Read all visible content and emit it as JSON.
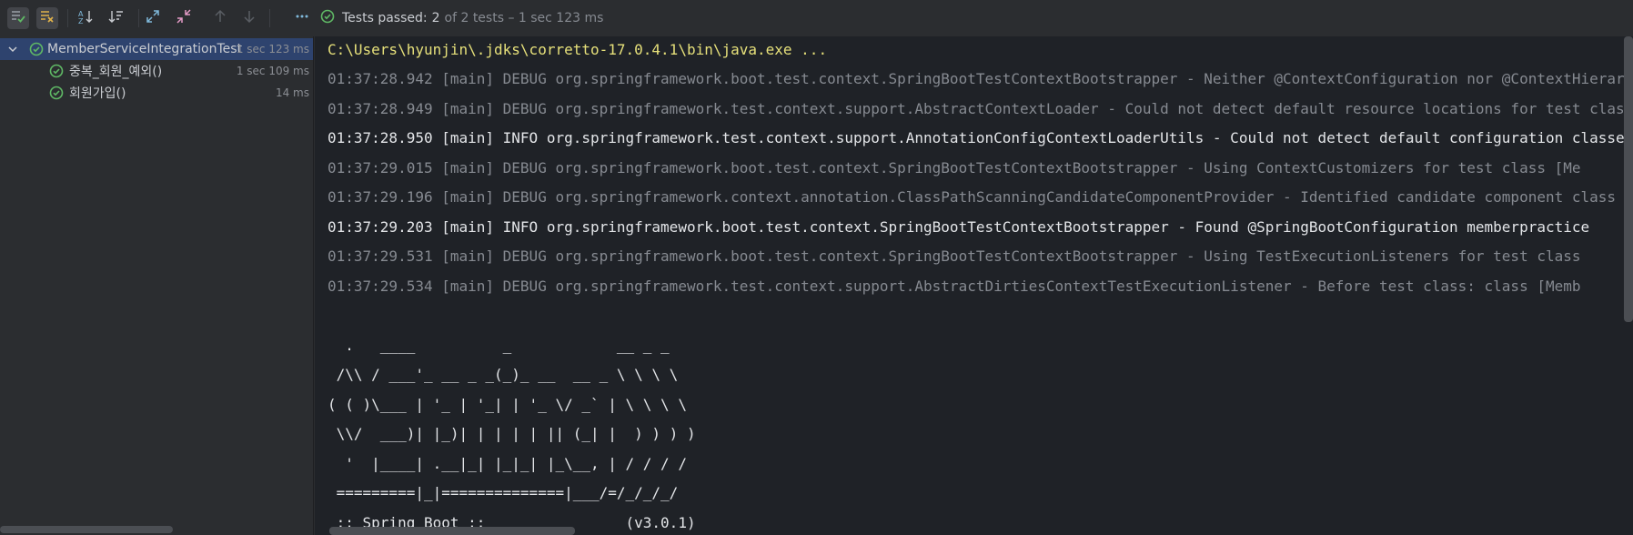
{
  "colors": {
    "accent_green": "#5fb865",
    "toolbar_active_bg": "#43454a",
    "selection_bg": "#2e436e",
    "console_bg": "#1f2227",
    "command_text": "#e6e07a"
  },
  "toolbar": {
    "buttons": [
      {
        "name": "show-passed-icon"
      },
      {
        "name": "show-ignored-icon"
      },
      {
        "name": "sort-alphabetically-icon"
      },
      {
        "name": "sort-by-duration-icon"
      },
      {
        "name": "expand-all-icon"
      },
      {
        "name": "collapse-all-icon"
      },
      {
        "name": "previous-failed-icon"
      },
      {
        "name": "next-failed-icon"
      },
      {
        "name": "more-options-icon"
      }
    ],
    "status_label": "Tests passed:",
    "status_count": "2",
    "status_rest": "of 2 tests – 1 sec 123 ms"
  },
  "tree": {
    "root": {
      "name": "MemberServiceIntegrationTest",
      "time": "1 sec 123 ms"
    },
    "children": [
      {
        "name": "중복_회원_예외()",
        "time": "1 sec 109 ms"
      },
      {
        "name": "회원가입()",
        "time": "14 ms"
      }
    ]
  },
  "console": {
    "command": "C:\\Users\\hyunjin\\.jdks\\corretto-17.0.4.1\\bin\\java.exe ...",
    "logs": [
      {
        "level": "debug",
        "text": "01:37:28.942 [main] DEBUG org.springframework.boot.test.context.SpringBootTestContextBootstrapper - Neither @ContextConfiguration nor @ContextHierarchy found for test class"
      },
      {
        "level": "debug",
        "text": "01:37:28.949 [main] DEBUG org.springframework.test.context.support.AbstractContextLoader - Could not detect default resource locations for test class"
      },
      {
        "level": "info",
        "text": "01:37:28.950 [main] INFO org.springframework.test.context.support.AnnotationConfigContextLoaderUtils - Could not detect default configuration classes"
      },
      {
        "level": "debug",
        "text": "01:37:29.015 [main] DEBUG org.springframework.boot.test.context.SpringBootTestContextBootstrapper - Using ContextCustomizers for test class [Me"
      },
      {
        "level": "debug",
        "text": "01:37:29.196 [main] DEBUG org.springframework.context.annotation.ClassPathScanningCandidateComponentProvider - Identified candidate component class"
      },
      {
        "level": "info",
        "text": "01:37:29.203 [main] INFO org.springframework.boot.test.context.SpringBootTestContextBootstrapper - Found @SpringBootConfiguration memberpractice"
      },
      {
        "level": "debug",
        "text": "01:37:29.531 [main] DEBUG org.springframework.boot.test.context.SpringBootTestContextBootstrapper - Using TestExecutionListeners for test class"
      },
      {
        "level": "debug",
        "text": "01:37:29.534 [main] DEBUG org.springframework.test.context.support.AbstractDirtiesContextTestExecutionListener - Before test class: class [Memb"
      }
    ],
    "banner": [
      "  .   ____          _            __ _ _",
      " /\\\\ / ___'_ __ _ _(_)_ __  __ _ \\ \\ \\ \\",
      "( ( )\\___ | '_ | '_| | '_ \\/ _` | \\ \\ \\ \\",
      " \\\\/  ___)| |_)| | | | | || (_| |  ) ) ) )",
      "  '  |____| .__|_| |_|_| |_\\__, | / / / /",
      " =========|_|==============|___/=/_/_/_/",
      " :: Spring Boot ::                (v3.0.1)"
    ]
  }
}
